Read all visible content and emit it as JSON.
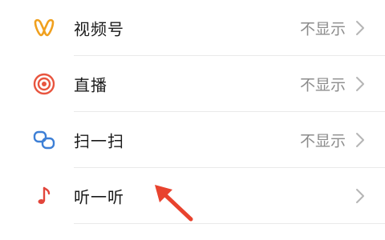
{
  "settings_list": {
    "items": [
      {
        "label": "视频号",
        "status": "不显示",
        "icon": "channels-icon"
      },
      {
        "label": "直播",
        "status": "不显示",
        "icon": "live-icon"
      },
      {
        "label": "扫一扫",
        "status": "不显示",
        "icon": "scan-icon"
      },
      {
        "label": "听一听",
        "status": "",
        "icon": "music-note-icon"
      }
    ]
  },
  "colors": {
    "channels_icon": "#f0a01e",
    "live_icon": "#e8553f",
    "scan_icon": "#3d7fd6",
    "music_icon": "#e2453b",
    "annotation_arrow": "#e8432e"
  }
}
